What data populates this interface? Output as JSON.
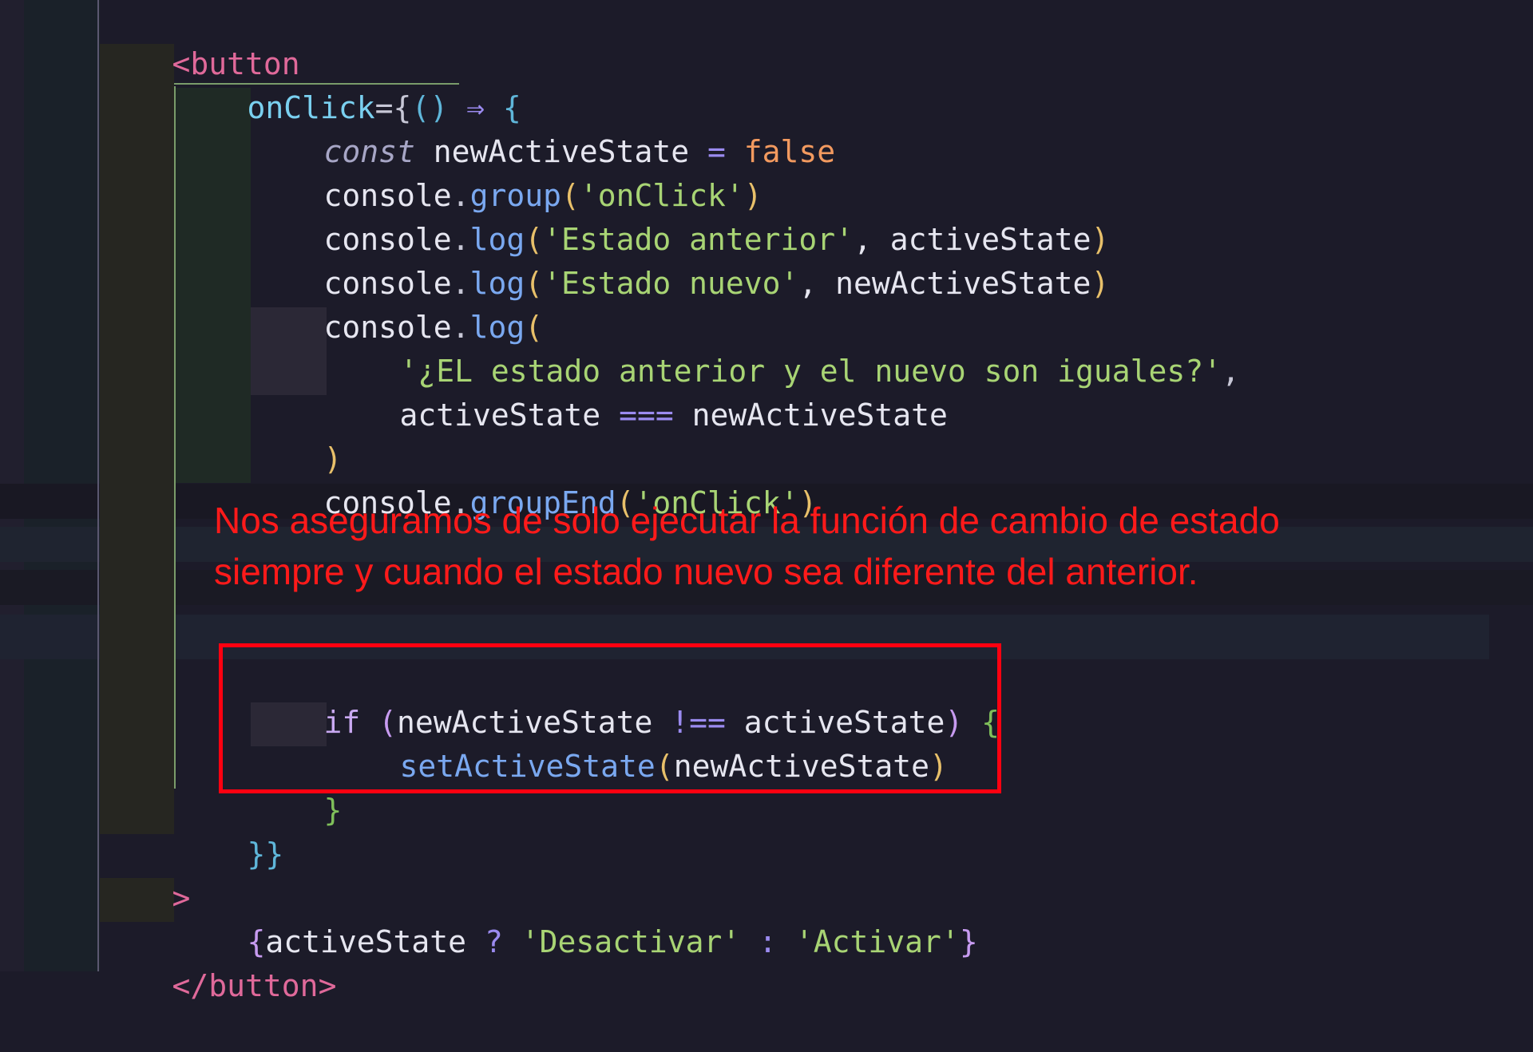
{
  "editor": {
    "theme_colors": {
      "background": "#1c1b29",
      "annotation": "#ff1a1a",
      "highlight_box": "#ff0010"
    },
    "lines": [
      {
        "t1": "<button"
      },
      {
        "t1": "onClick",
        "t2": "={",
        "t3": "()",
        "t4": " ⇒ ",
        "t5": "{"
      },
      {
        "t1": "const",
        "t2": " newActiveState ",
        "t3": "=",
        "t4": " false"
      },
      {
        "t1": "console",
        "t2": ".",
        "t3": "group",
        "t4": "(",
        "t5": "'onClick'",
        "t6": ")"
      },
      {
        "t1": "console",
        "t2": ".",
        "t3": "log",
        "t4": "(",
        "t5": "'Estado anterior'",
        "t6": ", activeState",
        "t7": ")"
      },
      {
        "t1": "console",
        "t2": ".",
        "t3": "log",
        "t4": "(",
        "t5": "'Estado nuevo'",
        "t6": ", newActiveState",
        "t7": ")"
      },
      {
        "t1": "console",
        "t2": ".",
        "t3": "log",
        "t4": "("
      },
      {
        "t1": "'¿EL estado anterior y el nuevo son iguales?'",
        "t2": ","
      },
      {
        "t1": "activeState ",
        "t2": "===",
        "t3": " newActiveState"
      },
      {
        "t1": ")"
      },
      {
        "t1": "console",
        "t2": ".",
        "t3": "groupEnd",
        "t4": "(",
        "t5": "'onClick'",
        "t6": ")"
      },
      {
        "t1": "if",
        "t2": " (",
        "t3": "newActiveState ",
        "t4": "!==",
        "t5": " activeState",
        "t6": ")",
        "t7": " {"
      },
      {
        "t1": "setActiveState",
        "t2": "(",
        "t3": "newActiveState",
        "t4": ")"
      },
      {
        "t1": "}"
      },
      {
        "t1": "}}"
      },
      {
        "t1": ">"
      },
      {
        "t1": "{",
        "t2": "activeState ",
        "t3": "?",
        "t4": " 'Desactivar' ",
        "t5": ":",
        "t6": " 'Activar'",
        "t7": "}"
      },
      {
        "t1": "</",
        "t2": "button",
        "t3": ">"
      }
    ],
    "annotation": {
      "line1": "Nos aseguramos de solo ejecutar la función de cambio de estado",
      "line2": "siempre y cuando el estado nuevo sea diferente del anterior."
    }
  }
}
